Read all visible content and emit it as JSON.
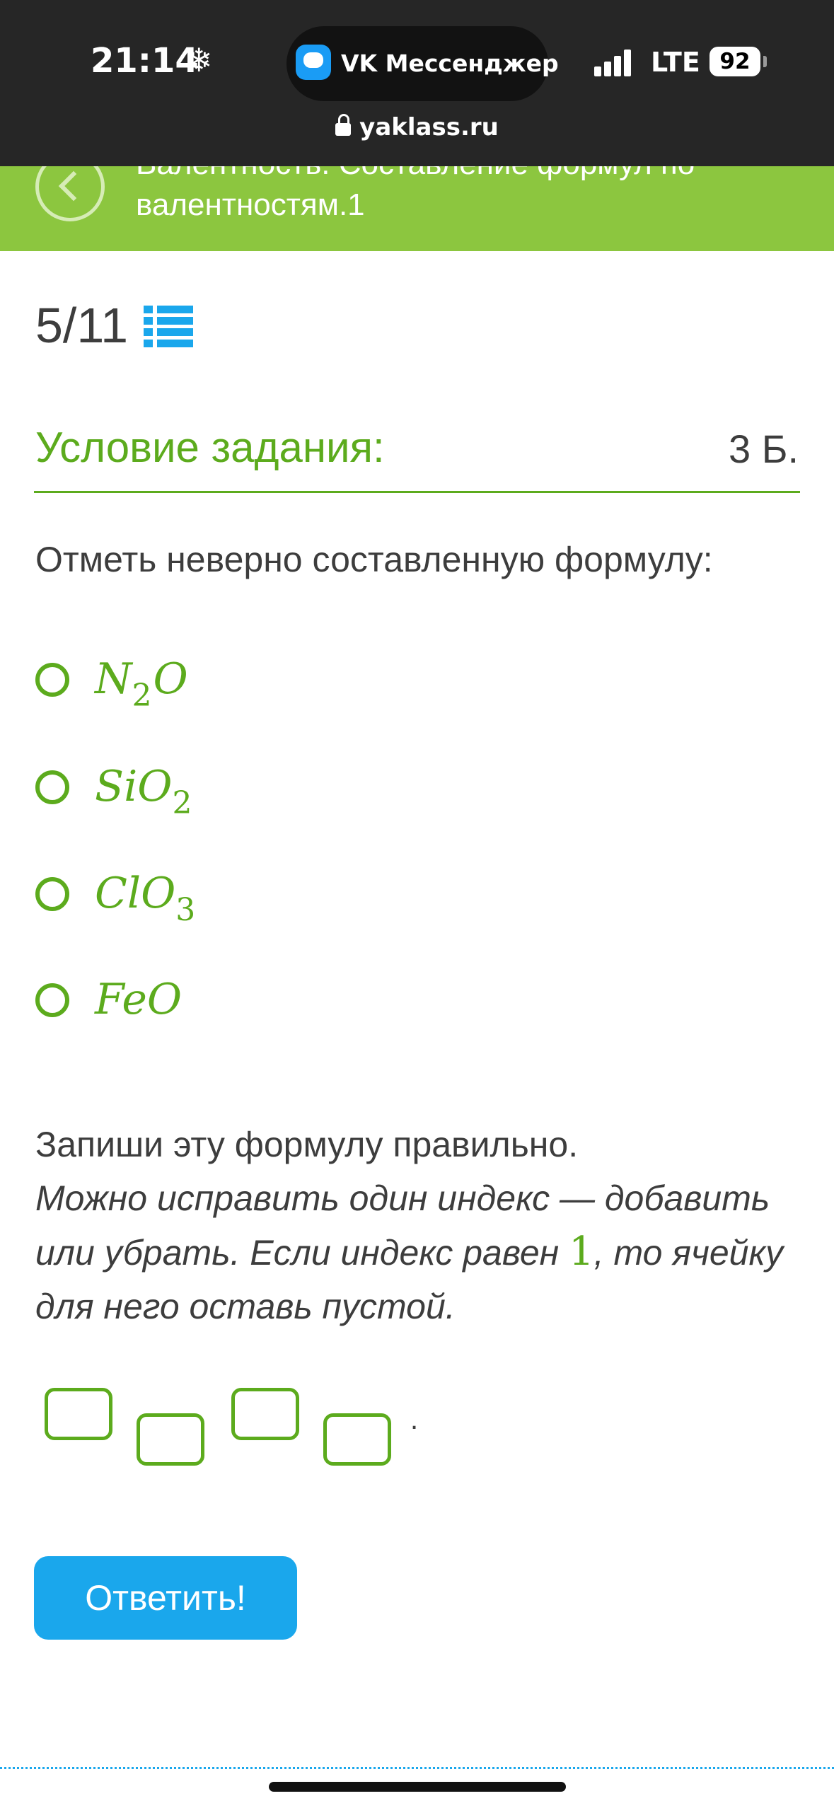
{
  "status": {
    "time": "21:14",
    "weather_glyph": "❄",
    "app_name": "VK Мессенджер",
    "network": "LTE",
    "battery": "92",
    "url": "yaklass.ru"
  },
  "header": {
    "title_line1": "Валентность. Составление формул по",
    "title_line2": "валентностям.1",
    "color": "#8cc63f"
  },
  "progress": "5/11",
  "task": {
    "title": "Условие задания:",
    "points": "3 Б.",
    "question": "Отметь неверно составленную формулу:",
    "options": [
      {
        "base": "N",
        "sub": "2",
        "tail": "O"
      },
      {
        "base": "SiO",
        "sub": "2",
        "tail": ""
      },
      {
        "base": "ClO",
        "sub": "3",
        "tail": ""
      },
      {
        "base": "FeO",
        "sub": "",
        "tail": ""
      }
    ],
    "instr_line1": "Запиши эту формулу правильно.",
    "instr_line2a": "Можно исправить один индекс — добавить или убрать. Если индекс равен ",
    "instr_num": "1",
    "instr_line2b": ", то ячейку для него оставь пустой.",
    "end_dot": "."
  },
  "submit_label": "Ответить!",
  "colors": {
    "accent_green": "#5cab1d",
    "accent_blue": "#1aa7ec"
  }
}
